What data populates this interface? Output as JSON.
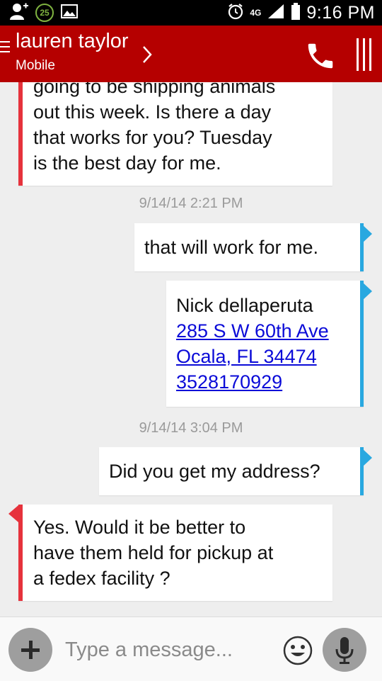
{
  "status_bar": {
    "notification_count": "25",
    "network": "4G",
    "time": "9:16 PM",
    "icons": [
      "add-contact-icon",
      "image-notification-icon",
      "alarm-icon",
      "signal-icon",
      "battery-icon"
    ]
  },
  "header": {
    "contact_name": "lauren taylor",
    "contact_subtitle": "Mobile",
    "icons": [
      "menu-icon",
      "chevron-right-icon",
      "phone-icon",
      "more-icon"
    ],
    "bar_color": "#b50000"
  },
  "conversation": {
    "messages": [
      {
        "direction": "in",
        "lines": [
          "going to be shipping animals",
          "out this week. Is there a day",
          "that works for you? Tuesday",
          "is the best day for me."
        ]
      },
      {
        "type": "timestamp",
        "text": "9/14/14 2:21 PM"
      },
      {
        "direction": "out",
        "lines": [
          "that will work for me."
        ]
      },
      {
        "direction": "out",
        "lines": [
          "Nick dellaperuta"
        ],
        "links": [
          "285 S W 60th Ave",
          "Ocala, FL 34474",
          "3528170929"
        ]
      },
      {
        "type": "timestamp",
        "text": "9/14/14 3:04 PM"
      },
      {
        "direction": "out",
        "lines": [
          "Did you get my address?"
        ]
      },
      {
        "direction": "in",
        "lines": [
          "Yes. Would it be better to",
          "have them held for pickup at",
          "a fedex facility ?"
        ]
      }
    ],
    "colors": {
      "incoming_accent": "#e6323c",
      "outgoing_accent": "#29a8e0",
      "link": "#0b0bd8"
    }
  },
  "composer": {
    "placeholder": "Type a message...",
    "icons": [
      "add-attachment-icon",
      "emoji-icon",
      "microphone-icon"
    ]
  }
}
